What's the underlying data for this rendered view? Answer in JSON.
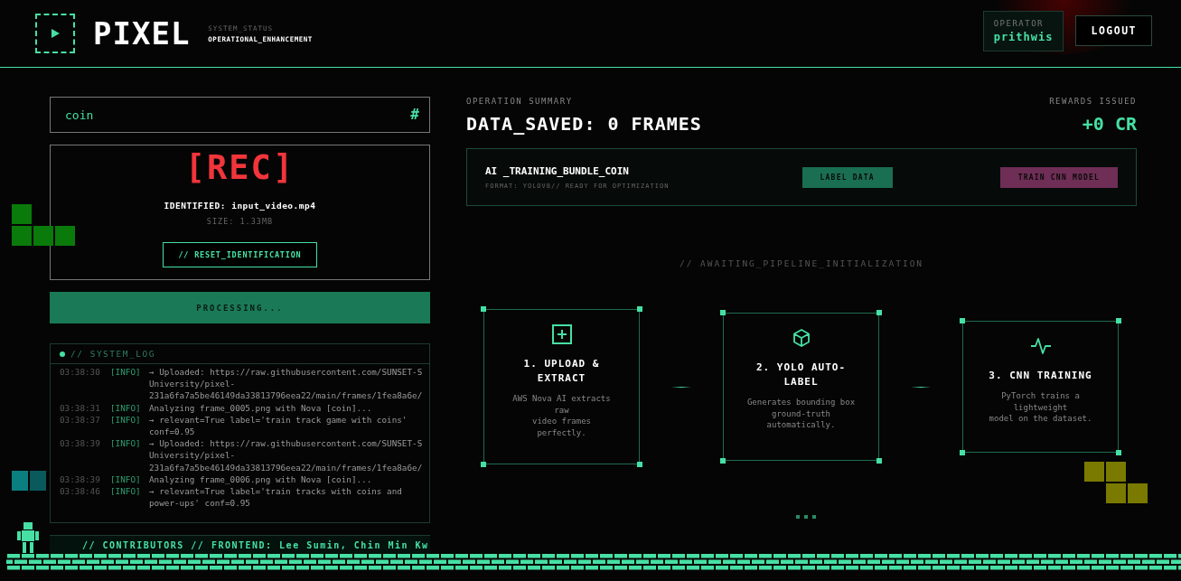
{
  "header": {
    "brand": "PIXEL",
    "status_label": "SYSTEM_STATUS",
    "status_value": "OPERATIONAL_ENHANCEMENT",
    "operator": {
      "label": "OPERATOR",
      "name": "prithwis"
    },
    "logout": "LOGOUT"
  },
  "search": {
    "value": "coin",
    "icon": "#"
  },
  "capture": {
    "rec": "[REC]",
    "identified": "IDENTIFIED: input_video.mp4",
    "size": "SIZE: 1.33MB",
    "reset": "// RESET_IDENTIFICATION"
  },
  "processing": "PROCESSING...",
  "system_log": {
    "title": "// SYSTEM_LOG",
    "entries": [
      {
        "time": "03:38:30",
        "level": "[INFO]",
        "lines": [
          "→ Uploaded: https://raw.githubusercontent.com/SUNSET-S",
          "University/pixel-",
          "231a6fa7a5be46149da33813796eea22/main/frames/1fea8a6e/"
        ]
      },
      {
        "time": "03:38:31",
        "level": "[INFO]",
        "lines": [
          "Analyzing frame_0005.png with Nova [coin]..."
        ]
      },
      {
        "time": "03:38:37",
        "level": "[INFO]",
        "lines": [
          "→ relevant=True label='train track game with coins'",
          "conf=0.95"
        ]
      },
      {
        "time": "03:38:39",
        "level": "[INFO]",
        "lines": [
          "→ Uploaded: https://raw.githubusercontent.com/SUNSET-S",
          "University/pixel-",
          "231a6fa7a5be46149da33813796eea22/main/frames/1fea8a6e/"
        ]
      },
      {
        "time": "03:38:39",
        "level": "[INFO]",
        "lines": [
          "Analyzing frame_0006.png with Nova [coin]..."
        ]
      },
      {
        "time": "03:38:46",
        "level": "[INFO]",
        "lines": [
          "→ relevant=True label='train tracks with coins and",
          "power-ups' conf=0.95"
        ]
      }
    ]
  },
  "contributors": "// CONTRIBUTORS // FRONTEND: Lee Sumin, Chin Min Kw",
  "summary": {
    "label": "OPERATION SUMMARY",
    "title": "DATA_SAVED: 0 FRAMES",
    "rewards_label": "REWARDS ISSUED",
    "rewards_value": "+0 CR"
  },
  "bundle": {
    "name": "AI _TRAINING_BUNDLE_COIN",
    "format": "FORMAT: YOLOV8// READY FOR OPTIMIZATION",
    "buttons": [
      {
        "label": "LABEL DATA",
        "kind": "label"
      },
      {
        "label": "TRAIN CNN MODEL",
        "kind": "train"
      }
    ]
  },
  "pipeline": {
    "status": "// AWAITING_PIPELINE_INITIALIZATION",
    "steps": [
      {
        "kind": "upload",
        "title": "1. UPLOAD & EXTRACT",
        "description": "AWS Nova AI extracts\nraw\nvideo frames\nperfectly."
      },
      {
        "kind": "cube",
        "title": "2. YOLO AUTO-LABEL",
        "description": "Generates bounding box\nground-truth\nautomatically."
      },
      {
        "kind": "pulse",
        "title": "3. CNN TRAINING",
        "description": "PyTorch trains a\nlightweight\nmodel on the dataset."
      }
    ]
  }
}
